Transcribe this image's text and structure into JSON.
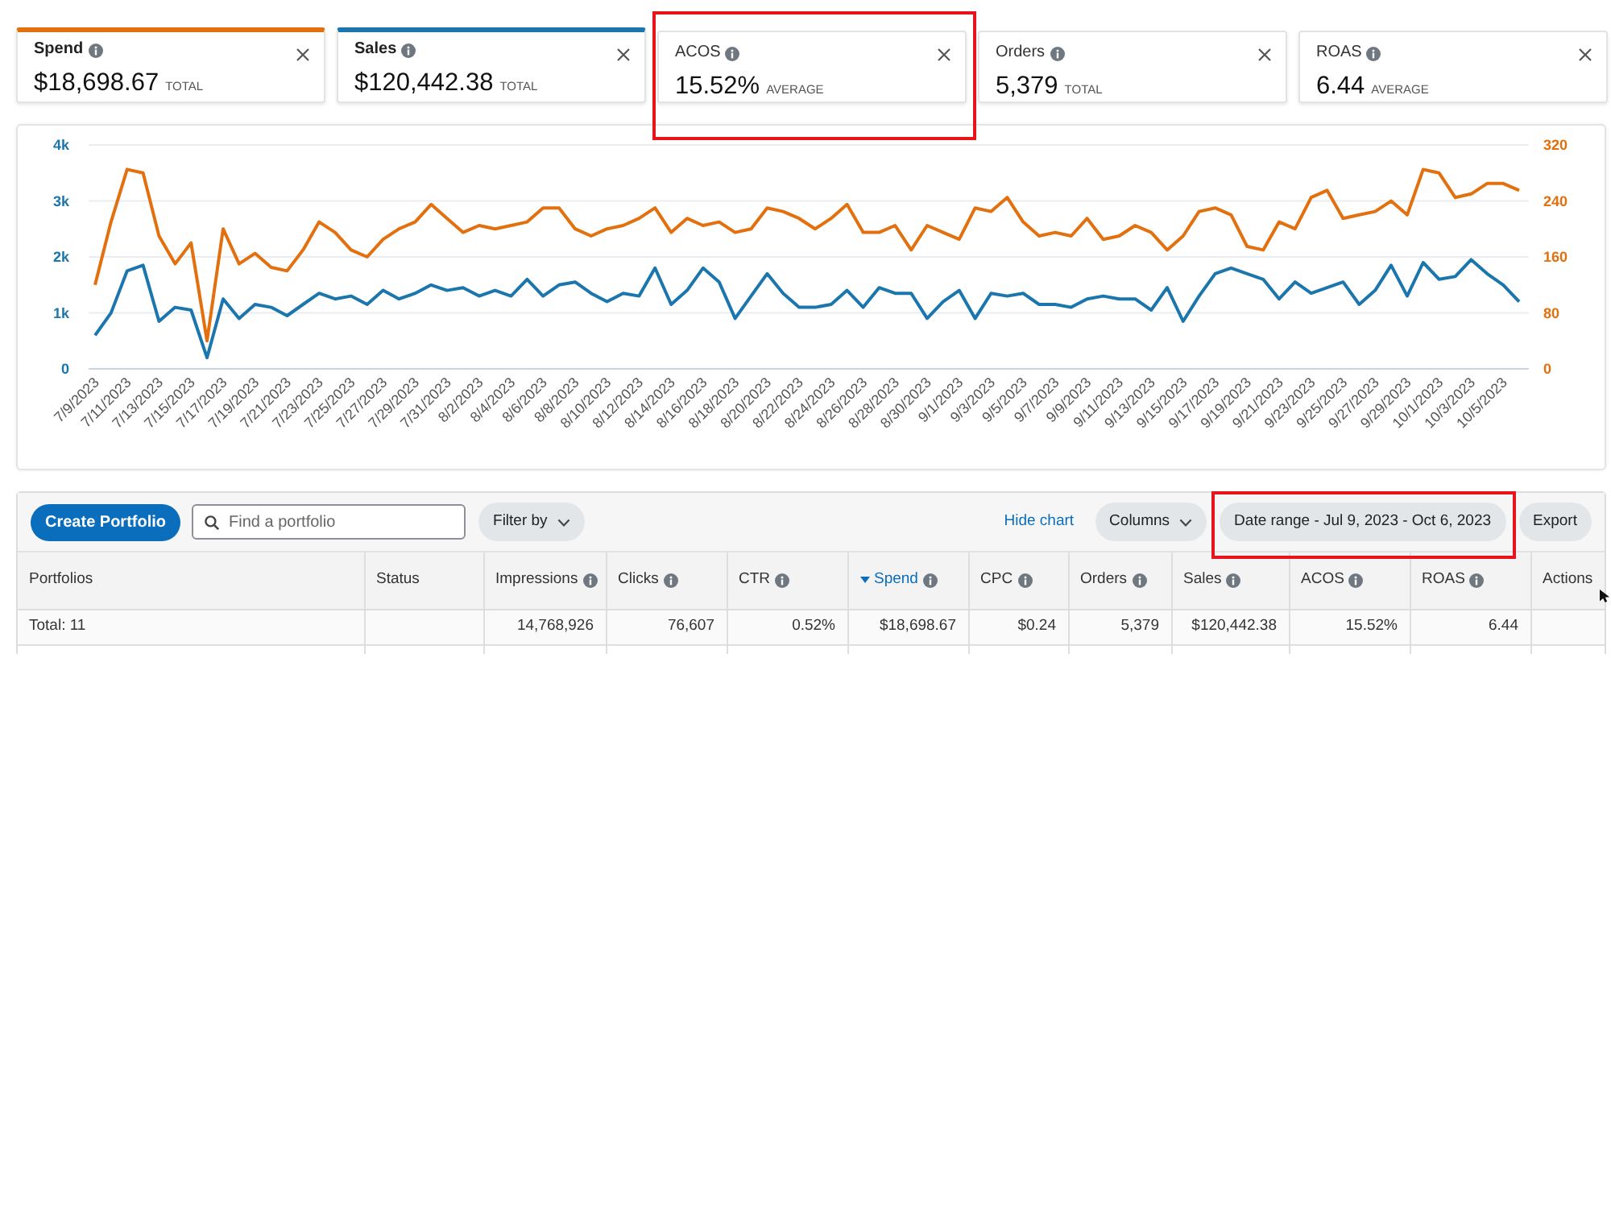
{
  "metrics": [
    {
      "label": "Spend",
      "value": "$18,698.67",
      "unit": "TOTAL",
      "selected": true,
      "color": "#e3700f",
      "highlighted": false
    },
    {
      "label": "Sales",
      "value": "$120,442.38",
      "unit": "TOTAL",
      "selected": true,
      "color": "#1b76ad",
      "highlighted": false
    },
    {
      "label": "ACOS",
      "value": "15.52%",
      "unit": "AVERAGE",
      "selected": false,
      "highlighted": true
    },
    {
      "label": "Orders",
      "value": "5,379",
      "unit": "TOTAL",
      "selected": false,
      "highlighted": false
    },
    {
      "label": "ROAS",
      "value": "6.44",
      "unit": "AVERAGE",
      "selected": false,
      "highlighted": false
    }
  ],
  "chart": {
    "chart_data": {
      "type": "line",
      "grid": true,
      "categories": [
        "7/9/2023",
        null,
        "7/11/2023",
        null,
        "7/13/2023",
        null,
        "7/15/2023",
        null,
        "7/17/2023",
        null,
        "7/19/2023",
        null,
        "7/21/2023",
        null,
        "7/23/2023",
        null,
        "7/25/2023",
        null,
        "7/27/2023",
        null,
        "7/29/2023",
        null,
        "7/31/2023",
        null,
        "8/2/2023",
        null,
        "8/4/2023",
        null,
        "8/6/2023",
        null,
        "8/8/2023",
        null,
        "8/10/2023",
        null,
        "8/12/2023",
        null,
        "8/14/2023",
        null,
        "8/16/2023",
        null,
        "8/18/2023",
        null,
        "8/20/2023",
        null,
        "8/22/2023",
        null,
        "8/24/2023",
        null,
        "8/26/2023",
        null,
        "8/28/2023",
        null,
        "8/30/2023",
        null,
        "9/1/2023",
        null,
        "9/3/2023",
        null,
        "9/5/2023",
        null,
        "9/7/2023",
        null,
        "9/9/2023",
        null,
        "9/11/2023",
        null,
        "9/13/2023",
        null,
        "9/15/2023",
        null,
        "9/17/2023",
        null,
        "9/19/2023",
        null,
        "9/21/2023",
        null,
        "9/23/2023",
        null,
        "9/25/2023",
        null,
        "9/27/2023",
        null,
        "9/29/2023",
        null,
        "10/1/2023",
        null,
        "10/3/2023",
        null,
        "10/5/2023",
        null
      ],
      "ylim": [
        0,
        4000
      ],
      "yticks": [
        {
          "value": 0,
          "label": "0"
        },
        {
          "value": 1000,
          "label": "1k"
        },
        {
          "value": 2000,
          "label": "2k"
        },
        {
          "value": 3000,
          "label": "3k"
        },
        {
          "value": 4000,
          "label": "4k"
        }
      ],
      "y2lim": [
        0,
        320
      ],
      "y2ticks": [
        0,
        80,
        160,
        240,
        320
      ],
      "series": [
        {
          "color": "#1b76ad",
          "values": [
            600,
            1000,
            1750,
            1850,
            850,
            1100,
            1050,
            200,
            1250,
            900,
            1150,
            1100,
            950,
            1150,
            1350,
            1250,
            1300,
            1150,
            1400,
            1250,
            1350,
            1500,
            1400,
            1450,
            1300,
            1400,
            1300,
            1600,
            1300,
            1500,
            1550,
            1350,
            1200,
            1350,
            1300,
            1800,
            1150,
            1400,
            1800,
            1550,
            900,
            1300,
            1700,
            1350,
            1100,
            1100,
            1150,
            1400,
            1100,
            1450,
            1350,
            1350,
            900,
            1200,
            1400,
            900,
            1350,
            1300,
            1350,
            1150,
            1150,
            1100,
            1250,
            1300,
            1250,
            1250,
            1050,
            1450,
            850,
            1300,
            1700,
            1800,
            1700,
            1600,
            1250,
            1550,
            1350,
            1450,
            1550,
            1150,
            1400,
            1850,
            1300,
            1900,
            1600,
            1650,
            1950,
            1700,
            1500,
            1200
          ]
        },
        {
          "color": "#e3700f",
          "axis": "y2",
          "values": [
            120,
            210,
            285,
            280,
            190,
            150,
            180,
            40,
            200,
            150,
            165,
            145,
            140,
            170,
            210,
            195,
            170,
            160,
            185,
            200,
            210,
            235,
            215,
            195,
            205,
            200,
            205,
            210,
            230,
            230,
            200,
            190,
            200,
            205,
            215,
            230,
            195,
            215,
            205,
            210,
            195,
            200,
            230,
            225,
            215,
            200,
            215,
            235,
            195,
            195,
            205,
            170,
            205,
            195,
            185,
            230,
            225,
            245,
            210,
            190,
            195,
            190,
            215,
            185,
            190,
            205,
            195,
            170,
            190,
            225,
            230,
            220,
            175,
            170,
            210,
            200,
            245,
            255,
            215,
            220,
            225,
            240,
            220,
            285,
            280,
            245,
            250,
            265,
            265,
            255
          ]
        }
      ]
    }
  },
  "toolbar": {
    "create_button": "Create Portfolio",
    "search": {
      "placeholder": "Find a portfolio"
    },
    "filter_button": "Filter by",
    "hide_chart_link": "Hide chart",
    "columns_button": "Columns",
    "date_range_button": {
      "label": "Date range - Jul 9, 2023 - Oct 6, 2023",
      "highlighted": true
    },
    "export_button": "Export"
  },
  "table": {
    "columns": [
      {
        "label": "Portfolios",
        "kind": "text",
        "info": false,
        "sorted": false
      },
      {
        "label": "Status",
        "kind": "text",
        "info": false,
        "sorted": false
      },
      {
        "label": "Impressions",
        "kind": "number",
        "info": true,
        "sorted": false
      },
      {
        "label": "Clicks",
        "kind": "number",
        "info": true,
        "sorted": false
      },
      {
        "label": "CTR",
        "kind": "number",
        "info": true,
        "sorted": false
      },
      {
        "label": "Spend",
        "kind": "number",
        "info": true,
        "sorted": true
      },
      {
        "label": "CPC",
        "kind": "number",
        "info": true,
        "sorted": false
      },
      {
        "label": "Orders",
        "kind": "number",
        "info": true,
        "sorted": false
      },
      {
        "label": "Sales",
        "kind": "number",
        "info": true,
        "sorted": false
      },
      {
        "label": "ACOS",
        "kind": "number",
        "info": true,
        "sorted": false
      },
      {
        "label": "ROAS",
        "kind": "number",
        "info": true,
        "sorted": false
      },
      {
        "label": "Actions",
        "kind": "text",
        "info": false,
        "sorted": false
      }
    ],
    "rows": [
      {
        "cells": [
          "Total: 11",
          null,
          "14,768,926",
          "76,607",
          "0.52%",
          "$18,698.67",
          "$0.24",
          "5,379",
          "$120,442.38",
          "15.52%",
          "6.44",
          null
        ]
      }
    ]
  }
}
